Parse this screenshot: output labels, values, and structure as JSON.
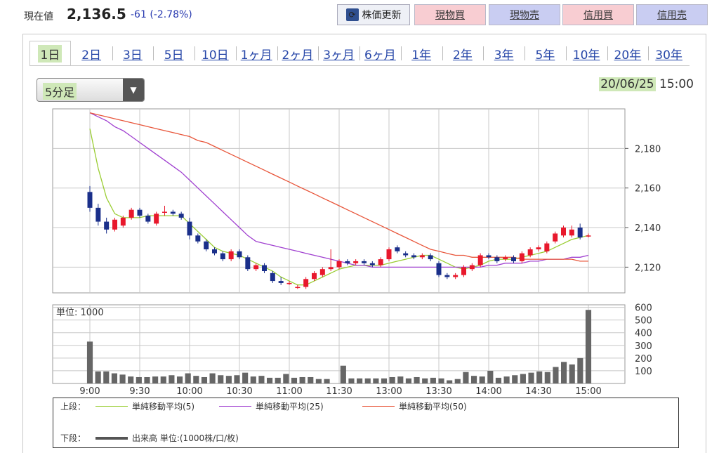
{
  "header": {
    "price_label": "現在値",
    "price": "2,136.5",
    "change": "-61 (-2.78%)",
    "buttons": {
      "refresh": "株価更新",
      "cash_buy": "現物買",
      "cash_sell": "現物売",
      "margin_buy": "信用買",
      "margin_sell": "信用売"
    }
  },
  "tabs": [
    "1日",
    "2日",
    "3日",
    "5日",
    "10日",
    "1ヶ月",
    "2ヶ月",
    "3ヶ月",
    "6ヶ月",
    "1年",
    "2年",
    "3年",
    "5年",
    "10年",
    "20年",
    "30年"
  ],
  "active_tab": "1日",
  "interval": "5分足",
  "date": "20/06/25",
  "time": "15:00",
  "colors": {
    "up": "#e8182c",
    "down": "#1a2f8a",
    "ma5": "#9acd32",
    "ma25": "#a040d0",
    "ma50": "#e8553a",
    "volume": "#666666",
    "grid": "#c8c8c8"
  },
  "chart_data": [
    {
      "type": "candlestick",
      "x_ticks": [
        "9:00",
        "9:30",
        "10:00",
        "10:30",
        "11:00",
        "11:30",
        "13:00",
        "13:30",
        "14:00",
        "14:30",
        "15:00"
      ],
      "yticks": [
        2120,
        2140,
        2160,
        2180
      ],
      "y_tick_labels": [
        "2,120",
        "2,140",
        "2,160",
        "2,180"
      ],
      "ylim": [
        2107,
        2200
      ],
      "candles": [
        {
          "o": 2158,
          "h": 2161,
          "l": 2148,
          "c": 2150
        },
        {
          "o": 2150,
          "h": 2152,
          "l": 2141,
          "c": 2143
        },
        {
          "o": 2143,
          "h": 2145,
          "l": 2137,
          "c": 2139
        },
        {
          "o": 2139,
          "h": 2145,
          "l": 2138,
          "c": 2144
        },
        {
          "o": 2141,
          "h": 2146,
          "l": 2140,
          "c": 2145
        },
        {
          "o": 2145,
          "h": 2150,
          "l": 2144,
          "c": 2149
        },
        {
          "o": 2149,
          "h": 2150,
          "l": 2145,
          "c": 2146
        },
        {
          "o": 2146,
          "h": 2147,
          "l": 2142,
          "c": 2143
        },
        {
          "o": 2142,
          "h": 2148,
          "l": 2141,
          "c": 2147
        },
        {
          "o": 2148,
          "h": 2151,
          "l": 2146,
          "c": 2148
        },
        {
          "o": 2148,
          "h": 2149,
          "l": 2146,
          "c": 2147
        },
        {
          "o": 2147,
          "h": 2148,
          "l": 2144,
          "c": 2145
        },
        {
          "o": 2143,
          "h": 2145,
          "l": 2134,
          "c": 2136
        },
        {
          "o": 2136,
          "h": 2137,
          "l": 2132,
          "c": 2133
        },
        {
          "o": 2133,
          "h": 2134,
          "l": 2128,
          "c": 2129
        },
        {
          "o": 2129,
          "h": 2130,
          "l": 2126,
          "c": 2127
        },
        {
          "o": 2127,
          "h": 2128,
          "l": 2123,
          "c": 2124
        },
        {
          "o": 2124,
          "h": 2129,
          "l": 2123,
          "c": 2128
        },
        {
          "o": 2128,
          "h": 2129,
          "l": 2124,
          "c": 2125
        },
        {
          "o": 2125,
          "h": 2126,
          "l": 2118,
          "c": 2119
        },
        {
          "o": 2119,
          "h": 2122,
          "l": 2118,
          "c": 2121
        },
        {
          "o": 2121,
          "h": 2122,
          "l": 2117,
          "c": 2118
        },
        {
          "o": 2117,
          "h": 2118,
          "l": 2112,
          "c": 2113
        },
        {
          "o": 2113,
          "h": 2115,
          "l": 2111,
          "c": 2112
        },
        {
          "o": 2112,
          "h": 2113,
          "l": 2111,
          "c": 2112
        },
        {
          "o": 2110,
          "h": 2111,
          "l": 2109,
          "c": 2110
        },
        {
          "o": 2110,
          "h": 2115,
          "l": 2109,
          "c": 2114
        },
        {
          "o": 2114,
          "h": 2118,
          "l": 2113,
          "c": 2117
        },
        {
          "o": 2116,
          "h": 2120,
          "l": 2115,
          "c": 2119
        },
        {
          "o": 2119,
          "h": 2129,
          "l": 2118,
          "c": 2120
        },
        {
          "o": 2120,
          "h": 2124,
          "l": 2119,
          "c": 2123
        },
        {
          "o": 2123,
          "h": 2124,
          "l": 2121,
          "c": 2122
        },
        {
          "o": 2122,
          "h": 2124,
          "l": 2121,
          "c": 2123
        },
        {
          "o": 2123,
          "h": 2124,
          "l": 2121,
          "c": 2122
        },
        {
          "o": 2122,
          "h": 2123,
          "l": 2120,
          "c": 2121
        },
        {
          "o": 2121,
          "h": 2125,
          "l": 2120,
          "c": 2124
        },
        {
          "o": 2124,
          "h": 2130,
          "l": 2123,
          "c": 2129
        },
        {
          "o": 2130,
          "h": 2131,
          "l": 2127,
          "c": 2128
        },
        {
          "o": 2127,
          "h": 2128,
          "l": 2125,
          "c": 2126
        },
        {
          "o": 2126,
          "h": 2127,
          "l": 2124,
          "c": 2125
        },
        {
          "o": 2125,
          "h": 2127,
          "l": 2124,
          "c": 2126
        },
        {
          "o": 2126,
          "h": 2127,
          "l": 2123,
          "c": 2124
        },
        {
          "o": 2122,
          "h": 2123,
          "l": 2115,
          "c": 2116
        },
        {
          "o": 2116,
          "h": 2117,
          "l": 2114,
          "c": 2115
        },
        {
          "o": 2115,
          "h": 2117,
          "l": 2114,
          "c": 2116
        },
        {
          "o": 2116,
          "h": 2121,
          "l": 2115,
          "c": 2120
        },
        {
          "o": 2119,
          "h": 2122,
          "l": 2118,
          "c": 2121
        },
        {
          "o": 2121,
          "h": 2127,
          "l": 2120,
          "c": 2126
        },
        {
          "o": 2126,
          "h": 2127,
          "l": 2124,
          "c": 2125
        },
        {
          "o": 2125,
          "h": 2126,
          "l": 2122,
          "c": 2123
        },
        {
          "o": 2124,
          "h": 2126,
          "l": 2123,
          "c": 2125
        },
        {
          "o": 2125,
          "h": 2126,
          "l": 2122,
          "c": 2123
        },
        {
          "o": 2123,
          "h": 2128,
          "l": 2122,
          "c": 2127
        },
        {
          "o": 2126,
          "h": 2130,
          "l": 2125,
          "c": 2129
        },
        {
          "o": 2129,
          "h": 2131,
          "l": 2128,
          "c": 2130
        },
        {
          "o": 2128,
          "h": 2133,
          "l": 2127,
          "c": 2132
        },
        {
          "o": 2133,
          "h": 2138,
          "l": 2132,
          "c": 2137
        },
        {
          "o": 2136,
          "h": 2141,
          "l": 2135,
          "c": 2140
        },
        {
          "o": 2136,
          "h": 2141,
          "l": 2135,
          "c": 2139
        },
        {
          "o": 2140,
          "h": 2142,
          "l": 2134,
          "c": 2135
        },
        {
          "o": 2136,
          "h": 2137,
          "l": 2135,
          "c": 2136
        }
      ],
      "series": [
        {
          "name": "単純移動平均(5)",
          "color_key": "ma5",
          "values": [
            2190,
            2170,
            2155,
            2147,
            2145,
            2145,
            2145,
            2146,
            2146,
            2146,
            2146,
            2146,
            2142,
            2138,
            2134,
            2130,
            2128,
            2127,
            2126,
            2124,
            2122,
            2120,
            2118,
            2115,
            2113,
            2111,
            2111,
            2113,
            2115,
            2117,
            2119,
            2120,
            2121,
            2121,
            2121,
            2121,
            2122,
            2123,
            2124,
            2125,
            2126,
            2126,
            2124,
            2122,
            2120,
            2119,
            2120,
            2121,
            2123,
            2124,
            2124,
            2124,
            2125,
            2126,
            2127,
            2128,
            2130,
            2132,
            2134,
            2135,
            2136
          ]
        },
        {
          "name": "単純移動平均(25)",
          "color_key": "ma25",
          "values": [
            2198,
            2196,
            2194,
            2191,
            2189,
            2186,
            2183,
            2180,
            2177,
            2174,
            2171,
            2168,
            2164,
            2160,
            2156,
            2152,
            2148,
            2144,
            2140,
            2136,
            2133,
            2132,
            2131,
            2130,
            2129,
            2128,
            2127,
            2126,
            2125,
            2124,
            2123,
            2122,
            2121,
            2121,
            2120,
            2120,
            2120,
            2120,
            2120,
            2120,
            2120,
            2120,
            2120,
            2120,
            2120,
            2120,
            2120,
            2120,
            2121,
            2121,
            2122,
            2122,
            2122,
            2123,
            2123,
            2124,
            2124,
            2124,
            2125,
            2125,
            2126
          ]
        },
        {
          "name": "単純移動平均(50)",
          "color_key": "ma50",
          "values": [
            2198,
            2197,
            2196,
            2195,
            2194,
            2193,
            2192,
            2191,
            2190,
            2189,
            2188,
            2187,
            2186,
            2184,
            2183,
            2181,
            2179,
            2177,
            2175,
            2173,
            2171,
            2169,
            2167,
            2165,
            2163,
            2161,
            2159,
            2157,
            2155,
            2153,
            2151,
            2149,
            2147,
            2145,
            2143,
            2141,
            2139,
            2137,
            2135,
            2133,
            2131,
            2129,
            2128,
            2127,
            2126,
            2126,
            2125,
            2125,
            2125,
            2125,
            2125,
            2125,
            2124,
            2124,
            2124,
            2124,
            2124,
            2124,
            2124,
            2123,
            2123
          ]
        }
      ]
    },
    {
      "type": "bar",
      "unit_label": "単位: 1000",
      "yticks": [
        100,
        200,
        300,
        400,
        500,
        600
      ],
      "ylim": [
        0,
        620
      ],
      "values": [
        330,
        95,
        95,
        80,
        70,
        55,
        50,
        50,
        55,
        55,
        65,
        55,
        80,
        60,
        50,
        80,
        65,
        60,
        65,
        85,
        55,
        60,
        45,
        45,
        75,
        45,
        50,
        50,
        35,
        35,
        0,
        140,
        40,
        40,
        40,
        40,
        40,
        50,
        55,
        40,
        50,
        40,
        45,
        40,
        25,
        35,
        90,
        60,
        55,
        100,
        45,
        55,
        65,
        75,
        85,
        95,
        90,
        130,
        170,
        150,
        200,
        580
      ],
      "x_ticks": [
        "9:00",
        "9:30",
        "10:00",
        "10:30",
        "11:00",
        "11:30",
        "13:00",
        "13:30",
        "14:00",
        "14:30",
        "15:00"
      ]
    }
  ],
  "legend": {
    "upper_label": "上段：",
    "lower_label": "下段：",
    "volume_label": "出来高 単位:(1000株/口/枚)"
  }
}
